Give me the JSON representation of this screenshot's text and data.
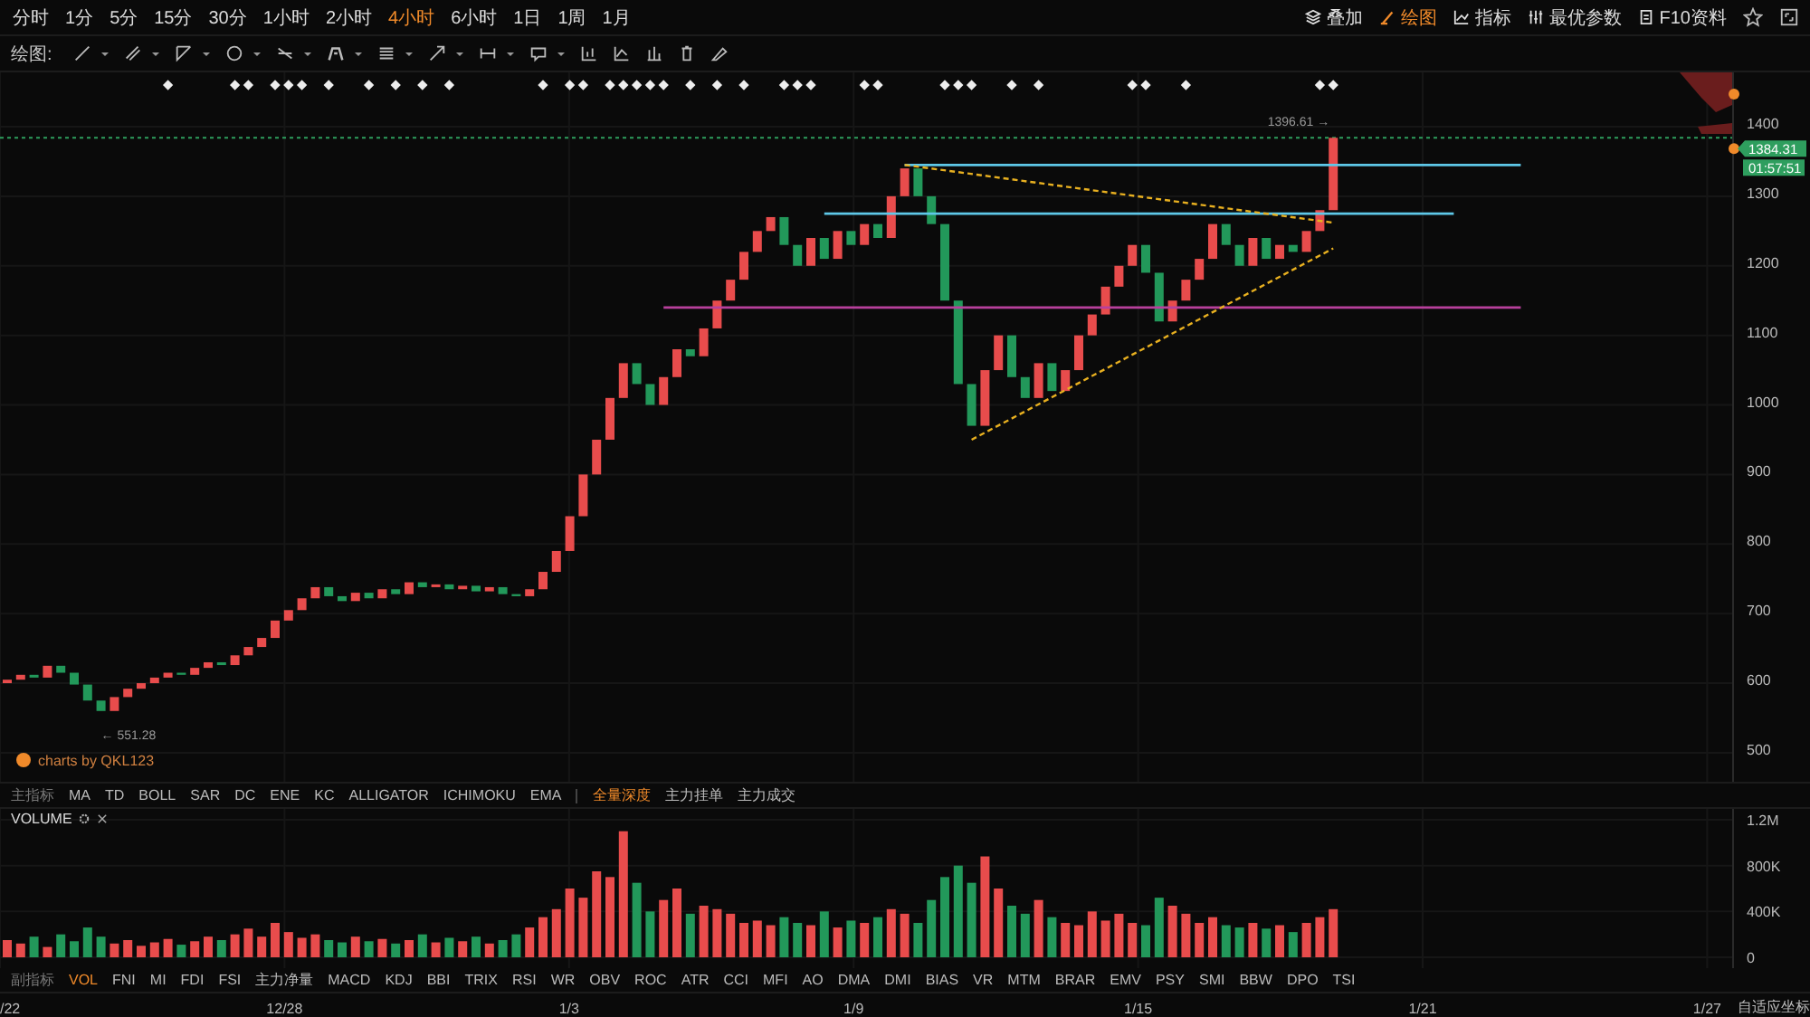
{
  "periods": [
    {
      "label": "分时",
      "selected": false
    },
    {
      "label": "1分",
      "selected": false
    },
    {
      "label": "5分",
      "selected": false
    },
    {
      "label": "15分",
      "selected": false
    },
    {
      "label": "30分",
      "selected": false
    },
    {
      "label": "1小时",
      "selected": false
    },
    {
      "label": "2小时",
      "selected": false
    },
    {
      "label": "4小时",
      "selected": true
    },
    {
      "label": "6小时",
      "selected": false
    },
    {
      "label": "1日",
      "selected": false
    },
    {
      "label": "1周",
      "selected": false
    },
    {
      "label": "1月",
      "selected": false
    }
  ],
  "right_actions": [
    {
      "label": "叠加",
      "selected": false
    },
    {
      "label": "绘图",
      "selected": true
    },
    {
      "label": "指标",
      "selected": false
    },
    {
      "label": "最优参数",
      "selected": false
    },
    {
      "label": "F10资料",
      "selected": false
    }
  ],
  "drawing_tools": {
    "label": "绘图:",
    "items": [
      {
        "has_menu": true
      },
      {
        "has_menu": true
      },
      {
        "has_menu": true
      },
      {
        "has_menu": true
      },
      {
        "has_menu": true
      },
      {
        "has_menu": true
      },
      {
        "has_menu": true
      },
      {
        "has_menu": true
      },
      {
        "has_menu": true
      },
      {
        "has_menu": true
      },
      {
        "has_menu": false
      },
      {
        "has_menu": false
      },
      {
        "has_menu": false
      },
      {
        "has_menu": false
      },
      {
        "has_menu": false
      }
    ]
  },
  "price_chart": {
    "credit": "charts by QKL123",
    "last_price": "1384.31",
    "countdown": "01:57:51",
    "high_label": "1396.61 →",
    "low_label": "← 551.28",
    "axis_labels": [
      "1400",
      "1300",
      "1200",
      "1100",
      "1000",
      "900",
      "800",
      "700",
      "600",
      "500"
    ]
  },
  "main_indicators": {
    "label": "主指标",
    "items": [
      {
        "label": "MA",
        "selected": false
      },
      {
        "label": "TD",
        "selected": false
      },
      {
        "label": "BOLL",
        "selected": false
      },
      {
        "label": "SAR",
        "selected": false
      },
      {
        "label": "DC",
        "selected": false
      },
      {
        "label": "ENE",
        "selected": false
      },
      {
        "label": "KC",
        "selected": false
      },
      {
        "label": "ALLIGATOR",
        "selected": false
      },
      {
        "label": "ICHIMOKU",
        "selected": false
      },
      {
        "label": "EMA",
        "selected": false
      }
    ],
    "overlays": [
      {
        "label": "全量深度",
        "selected": true
      },
      {
        "label": "主力挂单",
        "selected": false
      },
      {
        "label": "主力成交",
        "selected": false
      }
    ]
  },
  "volume_chart": {
    "title": "VOLUME",
    "axis_labels": [
      "1.2M",
      "800K",
      "400K",
      "0"
    ]
  },
  "sub_indicators": {
    "label": "副指标",
    "items": [
      {
        "label": "VOL",
        "selected": true
      },
      {
        "label": "FNI",
        "selected": false
      },
      {
        "label": "MI",
        "selected": false
      },
      {
        "label": "FDI",
        "selected": false
      },
      {
        "label": "FSI",
        "selected": false
      },
      {
        "label": "主力净量",
        "selected": false
      },
      {
        "label": "MACD",
        "selected": false
      },
      {
        "label": "KDJ",
        "selected": false
      },
      {
        "label": "BBI",
        "selected": false
      },
      {
        "label": "TRIX",
        "selected": false
      },
      {
        "label": "RSI",
        "selected": false
      },
      {
        "label": "WR",
        "selected": false
      },
      {
        "label": "OBV",
        "selected": false
      },
      {
        "label": "ROC",
        "selected": false
      },
      {
        "label": "ATR",
        "selected": false
      },
      {
        "label": "CCI",
        "selected": false
      },
      {
        "label": "MFI",
        "selected": false
      },
      {
        "label": "AO",
        "selected": false
      },
      {
        "label": "DMA",
        "selected": false
      },
      {
        "label": "DMI",
        "selected": false
      },
      {
        "label": "BIAS",
        "selected": false
      },
      {
        "label": "VR",
        "selected": false
      },
      {
        "label": "MTM",
        "selected": false
      },
      {
        "label": "BRAR",
        "selected": false
      },
      {
        "label": "EMV",
        "selected": false
      },
      {
        "label": "PSY",
        "selected": false
      },
      {
        "label": "SMI",
        "selected": false
      },
      {
        "label": "BBW",
        "selected": false
      },
      {
        "label": "DPO",
        "selected": false
      },
      {
        "label": "TSI",
        "selected": false
      }
    ]
  },
  "date_labels": [
    "/22",
    "12/28",
    "1/3",
    "1/9",
    "1/15",
    "1/21",
    "1/27"
  ],
  "axis_mode": "自适应坐标"
}
